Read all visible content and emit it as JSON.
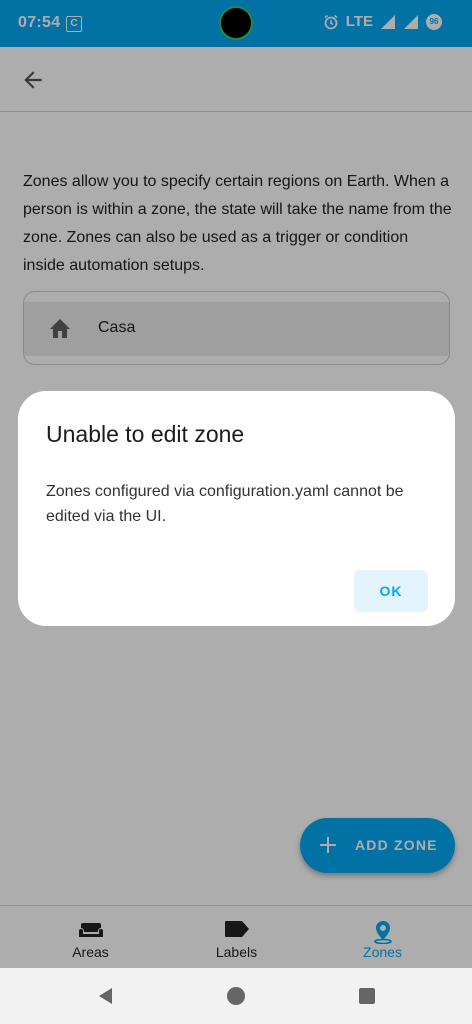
{
  "status_bar": {
    "time": "07:54",
    "app_badge": "C",
    "network": "LTE",
    "battery": "96"
  },
  "description": "Zones allow you to specify certain regions on Earth. When a person is within a zone, the state will take the name from the zone. Zones can also be used as a trigger or condition inside automation setups.",
  "zones": [
    {
      "name": "Casa",
      "icon": "home-icon"
    }
  ],
  "fab": {
    "label": "ADD ZONE"
  },
  "bottom_nav": [
    {
      "label": "Areas",
      "icon": "sofa-icon"
    },
    {
      "label": "Labels",
      "icon": "label-icon"
    },
    {
      "label": "Zones",
      "icon": "map-marker-icon",
      "active": true
    }
  ],
  "dialog": {
    "title": "Unable to edit zone",
    "body": "Zones configured via configuration.yaml cannot be edited via the UI.",
    "ok_label": "OK"
  },
  "colors": {
    "accent": "#03A9F4"
  }
}
